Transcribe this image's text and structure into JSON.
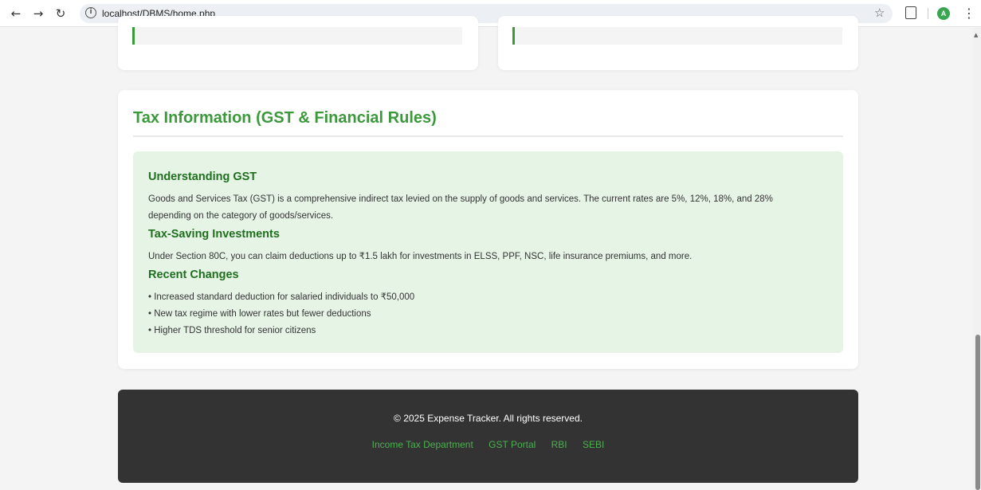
{
  "browser": {
    "url": "localhost/DBMS/home.php",
    "avatar_letter": "A",
    "icons": [
      "back-arrow-icon",
      "forward-arrow-icon",
      "reload-icon",
      "site-info-icon",
      "bookmark-star-icon",
      "extensions-icon",
      "profile-avatar",
      "menu-kebab-icon"
    ]
  },
  "tax_section": {
    "title": "Tax Information (GST & Financial Rules)",
    "blocks": [
      {
        "heading": "Understanding GST",
        "lines": [
          "Goods and Services Tax (GST) is a comprehensive indirect tax levied on the supply of goods and services. The current rates are 5%, 12%, 18%, and 28%",
          "depending on the category of goods/services."
        ]
      },
      {
        "heading": "Tax-Saving Investments",
        "lines": [
          "Under Section 80C, you can claim deductions up to ₹1.5 lakh for investments in ELSS, PPF, NSC, life insurance premiums, and more."
        ]
      },
      {
        "heading": "Recent Changes",
        "lines": [
          "• Increased standard deduction for salaried individuals to ₹50,000",
          "• New tax regime with lower rates but fewer deductions",
          "• Higher TDS threshold for senior citizens"
        ]
      }
    ]
  },
  "footer": {
    "copyright": "© 2025 Expense Tracker. All rights reserved.",
    "links": [
      "Income Tax Department",
      "GST Portal",
      "RBI",
      "SEBI"
    ]
  },
  "colors": {
    "accent": "#3a9a3a",
    "heading_dark": "#1f6f1f",
    "info_bg": "#e6f4e6",
    "footer_bg": "#333333",
    "footer_link": "#4caf50"
  }
}
